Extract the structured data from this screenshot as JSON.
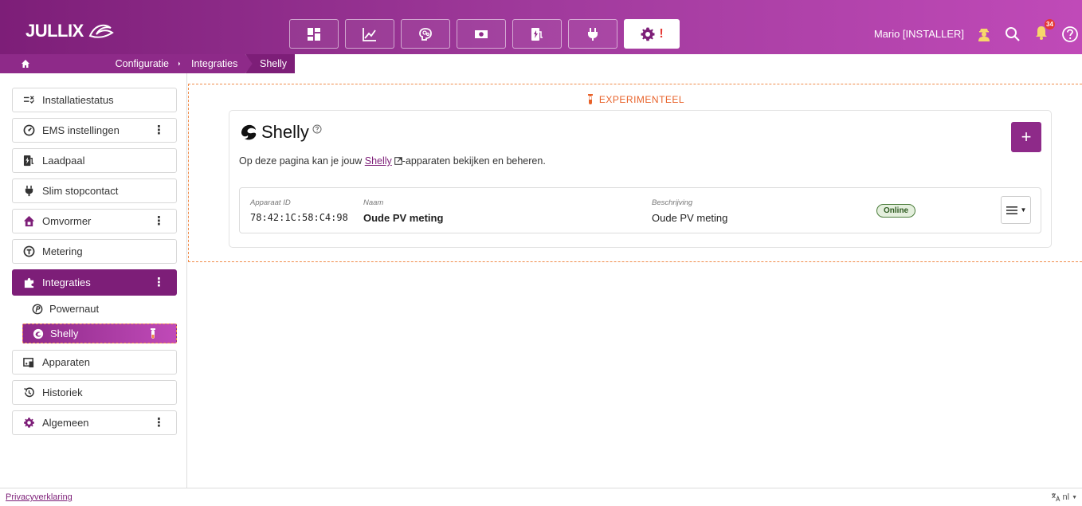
{
  "header": {
    "logo_text": "JULLIX",
    "user_label": "Mario [INSTALLER]",
    "notification_count": "34",
    "active_alert": "!"
  },
  "breadcrumb": {
    "configuratie": "Configuratie",
    "integraties": "Integraties",
    "shelly": "Shelly"
  },
  "sidebar": {
    "installatiestatus": "Installatiestatus",
    "ems": "EMS instellingen",
    "laadpaal": "Laadpaal",
    "slim": "Slim stopcontact",
    "omvormer": "Omvormer",
    "metering": "Metering",
    "integraties": "Integraties",
    "powernaut": "Powernaut",
    "shelly": "Shelly",
    "apparaten": "Apparaten",
    "historiek": "Historiek",
    "algemeen": "Algemeen",
    "dots": "⋮"
  },
  "main": {
    "experimental_label": "EXPERIMENTEEL",
    "title": "Shelly",
    "desc_before": "Op deze pagina kan je jouw ",
    "desc_link": "Shelly",
    "desc_after": "-apparaten bekijken en beheren.",
    "add_label": "+"
  },
  "device": {
    "id_label": "Apparaat ID",
    "id_value": "78:42:1C:58:C4:98",
    "name_label": "Naam",
    "name_value": "Oude PV meting",
    "desc_label": "Beschrijving",
    "desc_value": "Oude PV meting",
    "status": "Online"
  },
  "footer": {
    "privacy": "Privacyverklaring",
    "language": "nl"
  },
  "colors": {
    "brand": "#7d1e78",
    "experimental": "#e8622a",
    "online_bg": "#e4efdd"
  }
}
